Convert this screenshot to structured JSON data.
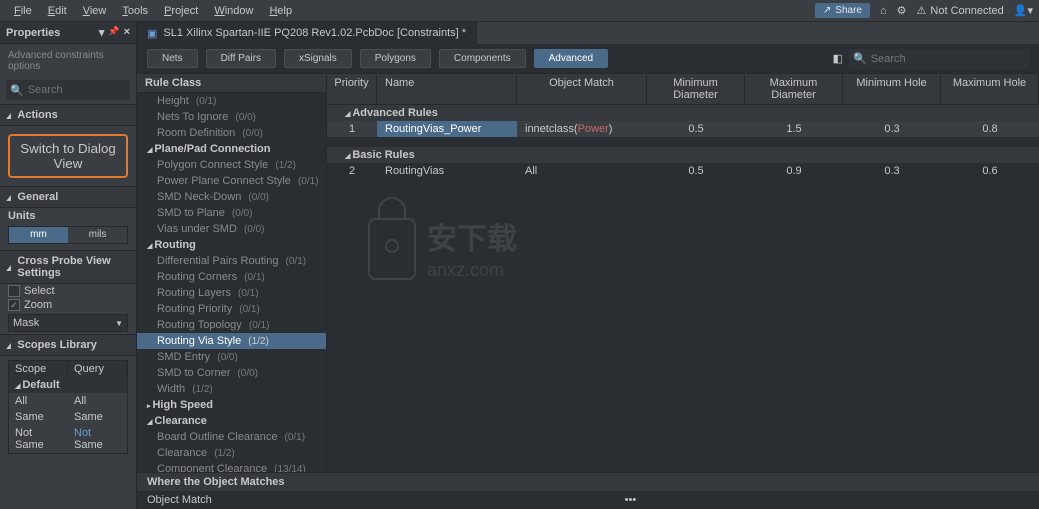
{
  "menu": {
    "items": [
      "File",
      "Edit",
      "View",
      "Tools",
      "Project",
      "Window",
      "Help"
    ]
  },
  "top_right": {
    "share": "Share",
    "status": "Not Connected"
  },
  "properties": {
    "title": "Properties",
    "subtitle": "Advanced constraints options",
    "search_placeholder": "Search",
    "actions": {
      "title": "Actions",
      "dialog_btn": "Switch to Dialog View"
    },
    "general": {
      "title": "General",
      "units_label": "Units",
      "mm": "mm",
      "mils": "mils"
    },
    "cross": {
      "title": "Cross Probe View Settings",
      "select": "Select",
      "zoom": "Zoom",
      "mask": "Mask"
    },
    "scopes": {
      "title": "Scopes Library",
      "col_scope": "Scope",
      "col_query": "Query",
      "default": "Default",
      "rows": [
        {
          "s": "All",
          "q": "All"
        },
        {
          "s": "Same",
          "q": "Same"
        },
        {
          "s": "Not Same",
          "q": "Not Same"
        }
      ]
    }
  },
  "doc": {
    "tab_title": "SL1 Xilinx Spartan-IIE PQ208 Rev1.02.PcbDoc [Constraints] *"
  },
  "filters": {
    "items": [
      "Nets",
      "Diff Pairs",
      "xSignals",
      "Polygons",
      "Components",
      "Advanced"
    ],
    "active": "Advanced",
    "search_placeholder": "Search"
  },
  "tree": {
    "header": "Rule Class",
    "lines": [
      {
        "t": "item",
        "label": "Height",
        "cnt": "(0/1)"
      },
      {
        "t": "item",
        "label": "Nets To Ignore",
        "cnt": "(0/0)"
      },
      {
        "t": "item",
        "label": "Room Definition",
        "cnt": "(0/0)"
      },
      {
        "t": "group",
        "label": "Plane/Pad Connection"
      },
      {
        "t": "item",
        "label": "Polygon Connect Style",
        "cnt": "(1/2)"
      },
      {
        "t": "item",
        "label": "Power Plane Connect Style",
        "cnt": "(0/1)"
      },
      {
        "t": "item",
        "label": "SMD Neck-Down",
        "cnt": "(0/0)"
      },
      {
        "t": "item",
        "label": "SMD to Plane",
        "cnt": "(0/0)"
      },
      {
        "t": "item",
        "label": "Vias under SMD",
        "cnt": "(0/0)"
      },
      {
        "t": "group",
        "label": "Routing"
      },
      {
        "t": "item",
        "label": "Differential Pairs Routing",
        "cnt": "(0/1)"
      },
      {
        "t": "item",
        "label": "Routing Corners",
        "cnt": "(0/1)"
      },
      {
        "t": "item",
        "label": "Routing Layers",
        "cnt": "(0/1)"
      },
      {
        "t": "item",
        "label": "Routing Priority",
        "cnt": "(0/1)"
      },
      {
        "t": "item",
        "label": "Routing Topology",
        "cnt": "(0/1)"
      },
      {
        "t": "item",
        "label": "Routing Via Style",
        "cnt": "(1/2)",
        "sel": true
      },
      {
        "t": "item",
        "label": "SMD Entry",
        "cnt": "(0/0)"
      },
      {
        "t": "item",
        "label": "SMD to Corner",
        "cnt": "(0/0)"
      },
      {
        "t": "item",
        "label": "Width",
        "cnt": "(1/2)"
      },
      {
        "t": "group",
        "label": "High Speed",
        "closed": true
      },
      {
        "t": "group",
        "label": "Clearance"
      },
      {
        "t": "item",
        "label": "Board Outline Clearance",
        "cnt": "(0/1)"
      },
      {
        "t": "item",
        "label": "Clearance",
        "cnt": "(1/2)"
      },
      {
        "t": "item",
        "label": "Component Clearance",
        "cnt": "(13/14)"
      }
    ]
  },
  "rules": {
    "cols": [
      "Priority",
      "Name",
      "Object Match",
      "Minimum Diameter",
      "Maximum Diameter",
      "Minimum Hole",
      "Maximum Hole"
    ],
    "adv_label": "Advanced Rules",
    "basic_label": "Basic Rules",
    "adv": [
      {
        "p": "1",
        "name": "RoutingVias_Power",
        "om_pre": "innetclass(",
        "om_tok": "Power",
        "om_post": ")",
        "c": [
          "0.5",
          "1.5",
          "0.3",
          "0.8"
        ],
        "sel": true
      }
    ],
    "basic": [
      {
        "p": "2",
        "name": "RoutingVias",
        "om": "All",
        "c": [
          "0.5",
          "0.9",
          "0.3",
          "0.6"
        ]
      }
    ]
  },
  "bottom": {
    "hdr": "Where the Object Matches",
    "label": "Object Match",
    "dots": "•••"
  }
}
